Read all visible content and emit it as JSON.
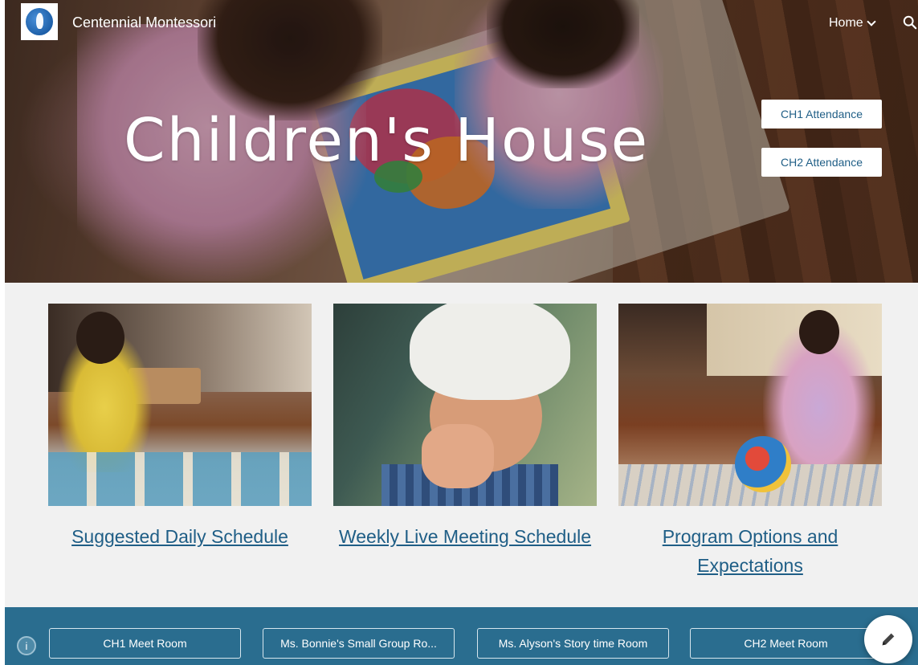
{
  "header": {
    "site_title": "Centennial Montessori",
    "nav_home": "Home",
    "icons": [
      "logo-globe-icon",
      "chevron-down-icon",
      "search-icon"
    ]
  },
  "hero": {
    "title": "Children's House",
    "buttons": [
      "CH1 Attendance",
      "CH2 Attendance"
    ]
  },
  "cards": [
    {
      "caption": "Suggested Daily Schedule"
    },
    {
      "caption": "Weekly Live Meeting Schedule"
    },
    {
      "caption": "Program Options and Expectations"
    }
  ],
  "footer": {
    "info_icon": "info-icon",
    "buttons": [
      "CH1 Meet Room",
      "Ms. Bonnie's Small Group Ro...",
      "Ms. Alyson's Story time Room",
      "CH2 Meet Room"
    ]
  },
  "fab": {
    "icon": "pencil-edit-icon"
  },
  "colors": {
    "link": "#1f5e86",
    "footer_bg": "#2a6d8f",
    "section_bg": "#f1f1f1"
  }
}
